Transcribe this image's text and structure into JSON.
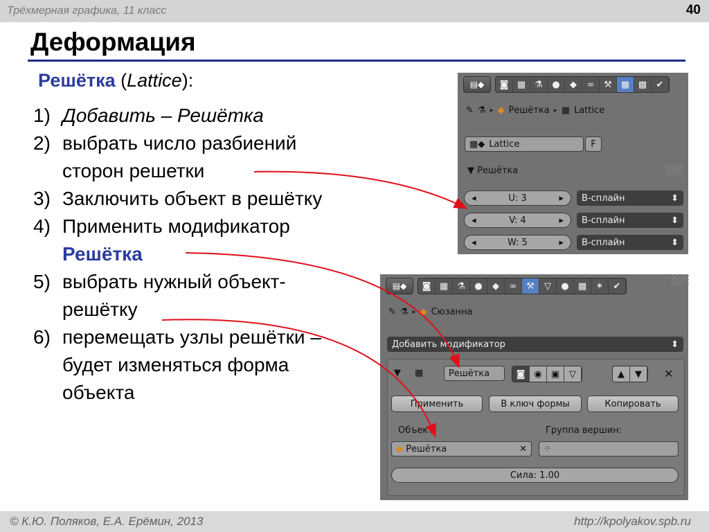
{
  "header": {
    "subtitle": "Трёхмерная графика, 11 класс",
    "page_number": "40"
  },
  "title": "Деформация",
  "lead": {
    "term": "Решётка",
    "open": " (",
    "latin": "Lattice",
    "close": "):"
  },
  "steps": [
    {
      "num": "1)",
      "text": "Добавить – Решётка"
    },
    {
      "num": "2)",
      "text": "выбрать число разбиений",
      "cont": "сторон решетки"
    },
    {
      "num": "3)",
      "text": "Заключить объект в решётку"
    },
    {
      "num": "4)",
      "text": "Применить модификатор",
      "cont": "Решётка"
    },
    {
      "num": "5)",
      "text": "выбрать нужный объект-",
      "cont": "решётку"
    },
    {
      "num": "6)",
      "text": "перемещать узлы решётки –",
      "cont": "будет изменяться форма",
      "cont2": "объекта"
    }
  ],
  "panel_lattice": {
    "crumb_obj": "Решётка",
    "crumb_data": "Lattice",
    "datablock_name": "Lattice",
    "fake_user": "F",
    "section": "Решётка",
    "rows": [
      {
        "label": "U: 3",
        "interp": "B-сплайн"
      },
      {
        "label": "V: 4",
        "interp": "B-сплайн"
      },
      {
        "label": "W: 5",
        "interp": "B-сплайн"
      }
    ]
  },
  "panel_modifier": {
    "crumb_obj": "Сюзанна",
    "add_modifier": "Добавить модификатор",
    "modifier_name": "Решётка",
    "apply": "Применить",
    "to_shape": "В ключ формы",
    "copy": "Копировать",
    "object_label": "Объект:",
    "vgroup_label": "Группа вершин:",
    "object_value": "Решётка",
    "strength": "Сила: 1.00"
  },
  "footer": {
    "authors": "© К.Ю. Поляков, Е.А. Ерёмин, 2013",
    "url": "http://kpolyakov.spb.ru"
  },
  "colors": {
    "accent": "#2b3c9b",
    "arrow": "#e0101a",
    "panel_bg": "#727272"
  }
}
